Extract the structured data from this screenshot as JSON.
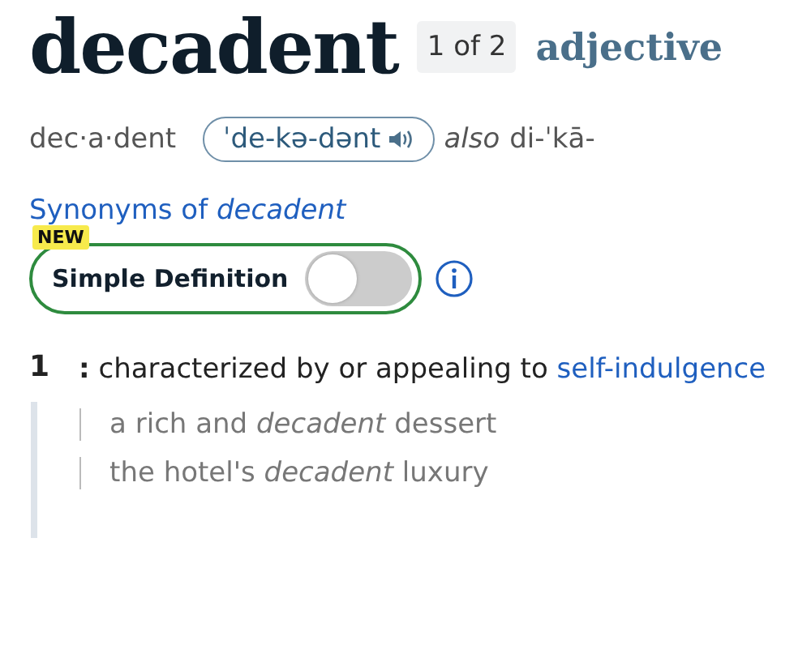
{
  "headword": "decadent",
  "entry_count": "1 of 2",
  "part_of_speech": "adjective",
  "syllables": "dec·a·dent",
  "pronunciation": "ˈde-kə-dənt",
  "variant_label": "also",
  "variant_pronunciation": "di-ˈkā-",
  "synonyms_link": "Synonyms of *decadent*",
  "simple_definition": {
    "badge": "NEW",
    "label": "Simple Definition",
    "on": false
  },
  "senses": [
    {
      "number": "1",
      "colon": ":",
      "text": "characterized by or appealing to",
      "link": "self-indulgence",
      "examples": [
        "a rich and *decadent* dessert",
        "the hotel's *decadent* luxury"
      ]
    }
  ]
}
